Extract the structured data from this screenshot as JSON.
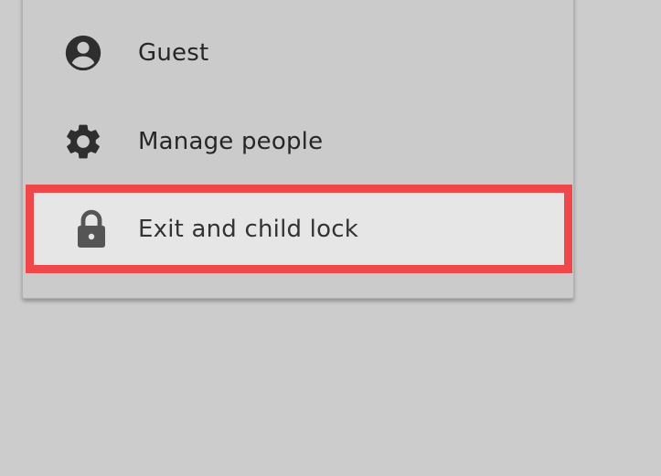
{
  "menu": {
    "items": [
      {
        "label": "Guest",
        "icon": "account-circle-icon"
      },
      {
        "label": "Manage people",
        "icon": "gear-icon"
      },
      {
        "label": "Exit and child lock",
        "icon": "lock-icon",
        "highlighted": true
      }
    ]
  },
  "colors": {
    "background": "#cccccc",
    "menu_background": "#cbcbcb",
    "highlight_background": "#e6e6e6",
    "highlight_border": "#f0474b",
    "icon": "#2e2e2e",
    "lock_icon": "#555555"
  }
}
